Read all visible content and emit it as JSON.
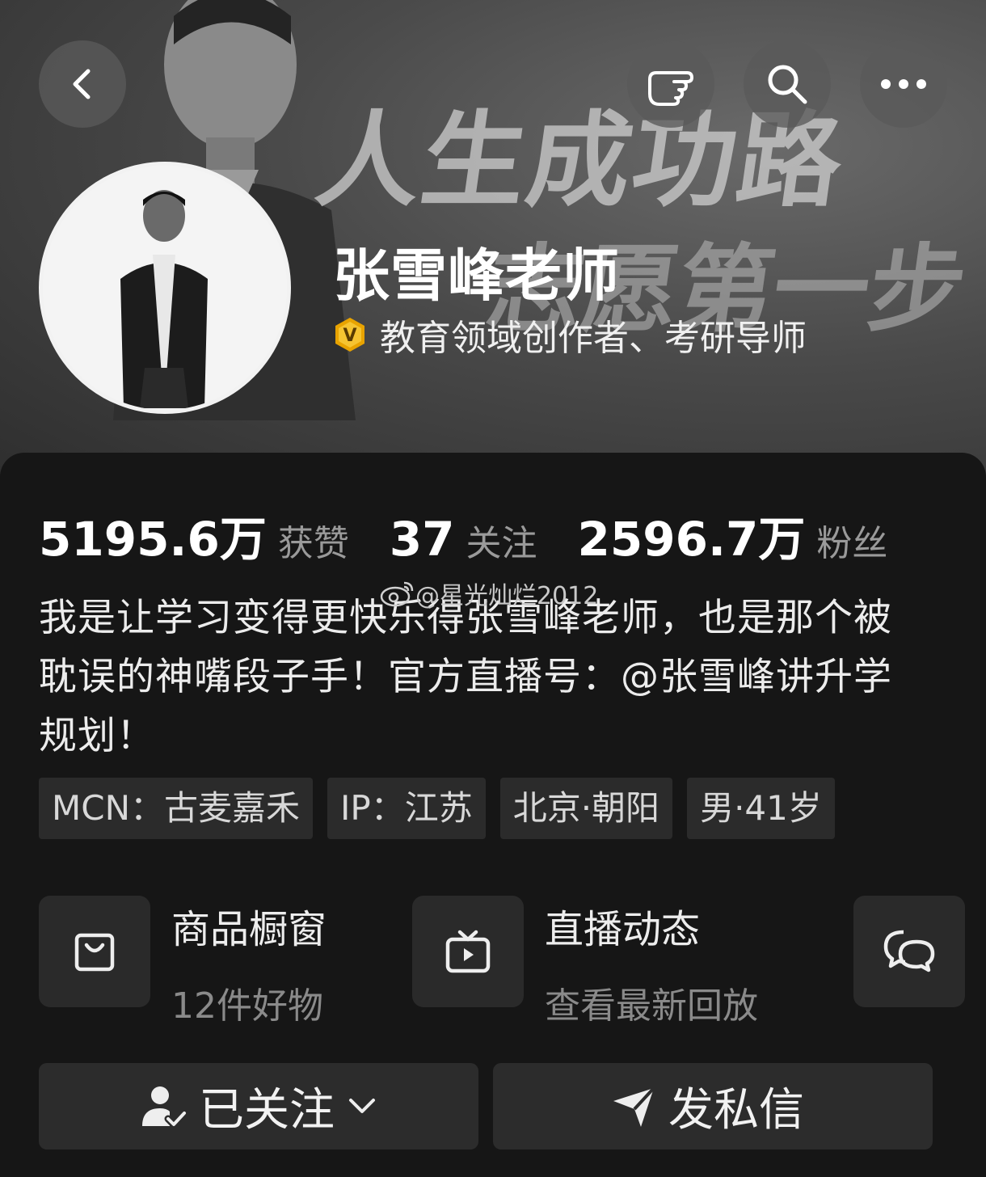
{
  "header": {
    "banner_headline_line1": "人生成功路",
    "banner_headline_line2": "志愿第一步",
    "back_icon": "chevron-left-icon",
    "gesture_icon": "pointing-hand-icon",
    "search_icon": "search-icon",
    "more_icon": "more-horizontal-icon"
  },
  "profile": {
    "name": "张雪峰老师",
    "verified_badge": "V",
    "verified_text": "教育领域创作者、考研导师",
    "badge_color": "#e8a300"
  },
  "stats": {
    "likes_value": "5195.6万",
    "likes_label": "获赞",
    "following_value": "37",
    "following_label": "关注",
    "fans_value": "2596.7万",
    "fans_label": "粉丝"
  },
  "watermark": {
    "text": "@星光灿烂2012",
    "icon": "weibo-logo-icon"
  },
  "bio": {
    "line1": "我是让学习变得更快乐得张雪峰老师，也是那个被",
    "line2": "耽误的神嘴段子手！官方直播号：@张雪峰讲升学",
    "line3": "规划！"
  },
  "tags": [
    "MCN：古麦嘉禾",
    "IP：江苏",
    "北京·朝阳",
    "男·41岁"
  ],
  "features": {
    "shop_title": "商品橱窗",
    "shop_sub": "12件好物",
    "live_title": "直播动态",
    "live_sub": "查看最新回放"
  },
  "actions": {
    "follow_label": "已关注",
    "message_label": "发私信"
  }
}
